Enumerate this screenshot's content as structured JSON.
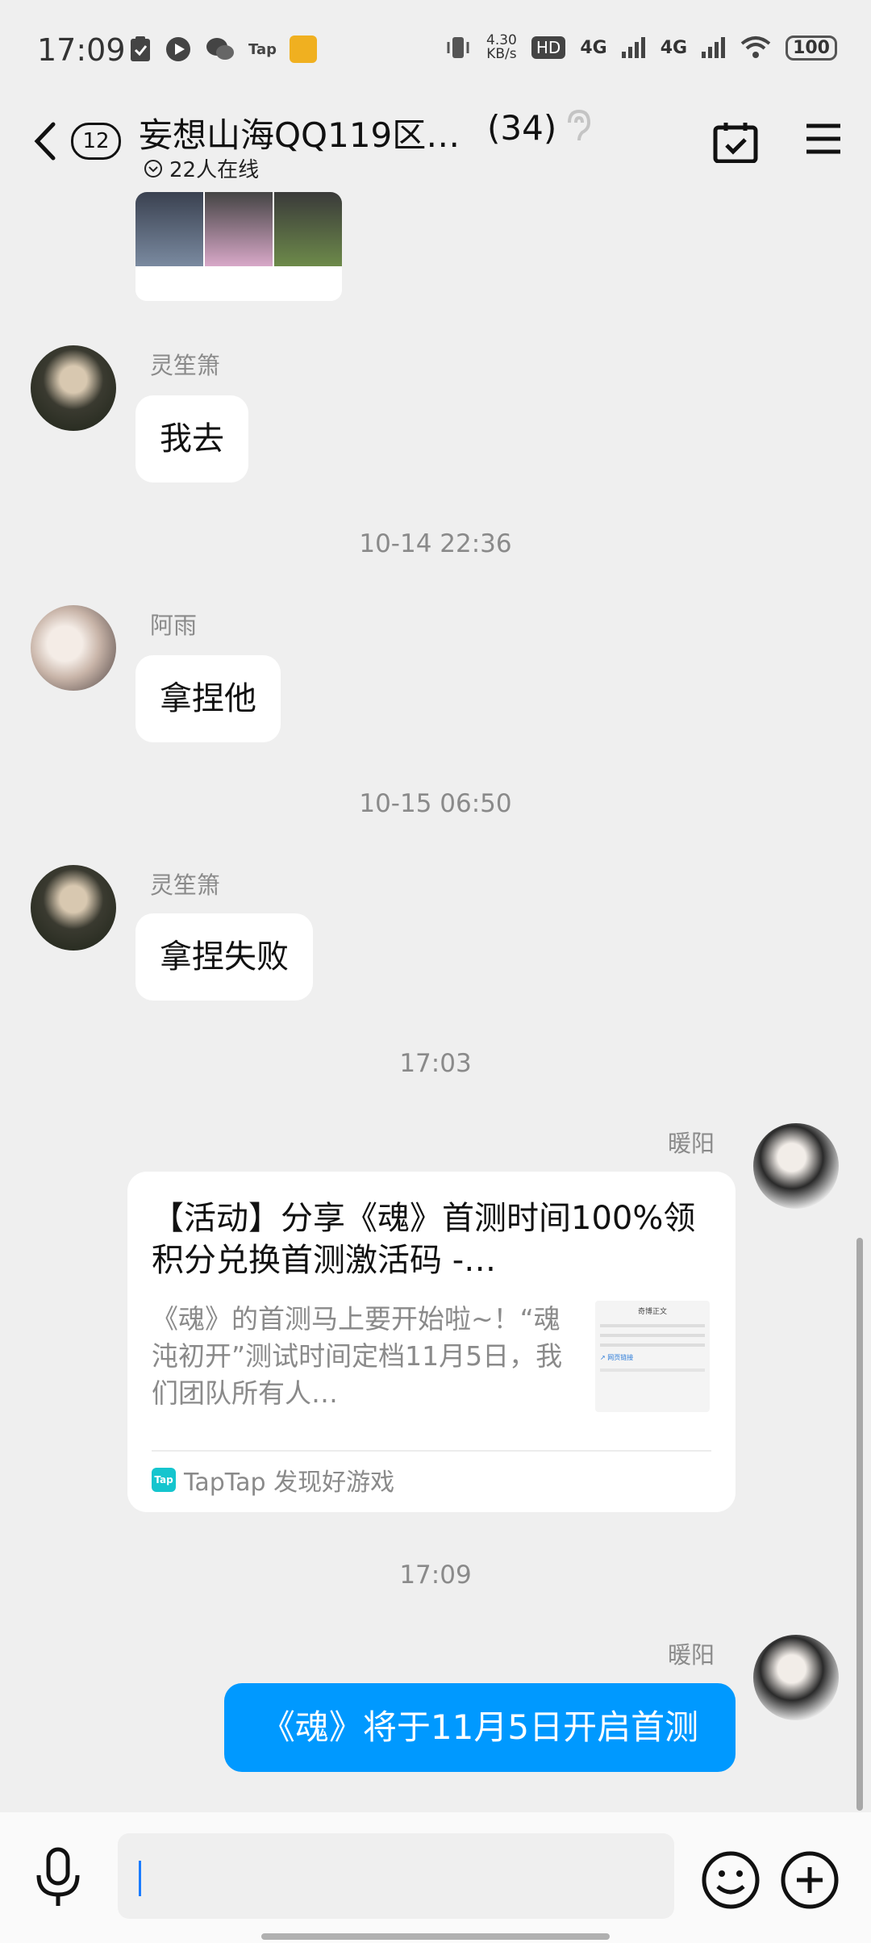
{
  "status_bar": {
    "time": "17:09",
    "speed_value": "4.30",
    "speed_unit": "KB/s",
    "hd": "HD",
    "net1": "4G",
    "net2": "4G",
    "battery": "100",
    "app_icons": [
      "clipboard-icon",
      "video-icon",
      "wechat-icon",
      "tap-icon",
      "game-icon"
    ]
  },
  "header": {
    "back_count": "12",
    "title": "妄想山海QQ119区…",
    "member_count": "(34)",
    "online_text": "22人在线"
  },
  "messages": {
    "m1": {
      "sender": "灵笙箫",
      "text": "我去"
    },
    "ts1": "10-14 22:36",
    "m2": {
      "sender": "阿雨",
      "text": "拿捏他"
    },
    "ts2": "10-15 06:50",
    "m3": {
      "sender": "灵笙箫",
      "text": "拿捏失败"
    },
    "ts3": "17:03",
    "m4": {
      "sender": "暖阳",
      "title": "【活动】分享《魂》首测时间100%领积分兑换首测激活码 -…",
      "description": "《魂》的首测马上要开始啦~！“魂沌初开”测试时间定档11月5日，我们团队所有人…",
      "source": "TapTap 发现好游戏",
      "thumb_heading": "奇博正文",
      "thumb_link": "↗ 网页链接"
    },
    "ts4": "17:09",
    "m5": {
      "sender": "暖阳",
      "text": "《魂》将于11月5日开启首测"
    }
  },
  "input": {
    "placeholder": ""
  },
  "colors": {
    "accent": "#0099ff",
    "background": "#efefef",
    "taptap": "#15c5ce"
  }
}
